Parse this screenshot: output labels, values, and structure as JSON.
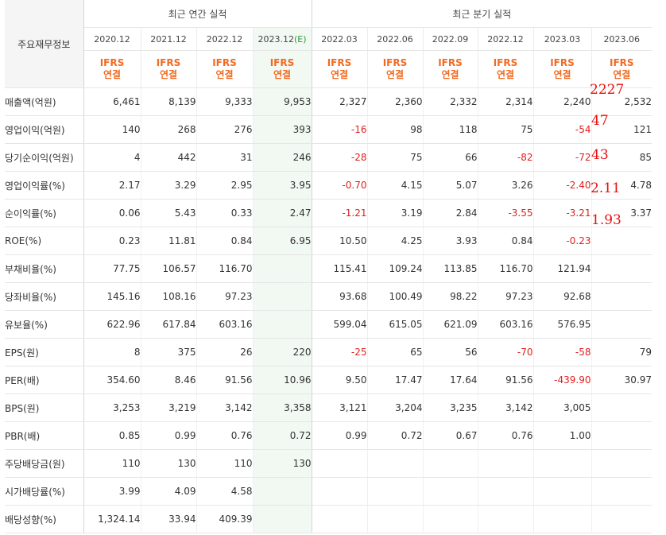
{
  "corner_label": "주요재무정보",
  "groups": {
    "annual": "최근 연간 실적",
    "quarter": "최근 분기 실적"
  },
  "periods": [
    "2020.12",
    "2021.12",
    "2022.12",
    "2023.12",
    "2022.03",
    "2022.06",
    "2022.09",
    "2022.12",
    "2023.03",
    "2023.06"
  ],
  "estimate_mark": "(E)",
  "basis_line1": "IFRS",
  "basis_line2": "연결",
  "rows": [
    {
      "label": "매출액(억원)",
      "values": [
        "6,461",
        "8,139",
        "9,333",
        "9,953",
        "2,327",
        "2,360",
        "2,332",
        "2,314",
        "2,240",
        "2,532"
      ]
    },
    {
      "label": "영업이익(억원)",
      "values": [
        "140",
        "268",
        "276",
        "393",
        "-16",
        "98",
        "118",
        "75",
        "-54",
        "121"
      ]
    },
    {
      "label": "당기순이익(억원)",
      "values": [
        "4",
        "442",
        "31",
        "246",
        "-28",
        "75",
        "66",
        "-82",
        "-72",
        "85"
      ]
    },
    {
      "label": "영업이익률(%)",
      "values": [
        "2.17",
        "3.29",
        "2.95",
        "3.95",
        "-0.70",
        "4.15",
        "5.07",
        "3.26",
        "-2.40",
        "4.78"
      ]
    },
    {
      "label": "순이익률(%)",
      "values": [
        "0.06",
        "5.43",
        "0.33",
        "2.47",
        "-1.21",
        "3.19",
        "2.84",
        "-3.55",
        "-3.21",
        "3.37"
      ]
    },
    {
      "label": "ROE(%)",
      "values": [
        "0.23",
        "11.81",
        "0.84",
        "6.95",
        "10.50",
        "4.25",
        "3.93",
        "0.84",
        "-0.23",
        ""
      ]
    },
    {
      "label": "부채비율(%)",
      "values": [
        "77.75",
        "106.57",
        "116.70",
        "",
        "115.41",
        "109.24",
        "113.85",
        "116.70",
        "121.94",
        ""
      ]
    },
    {
      "label": "당좌비율(%)",
      "values": [
        "145.16",
        "108.16",
        "97.23",
        "",
        "93.68",
        "100.49",
        "98.22",
        "97.23",
        "92.68",
        ""
      ]
    },
    {
      "label": "유보율(%)",
      "values": [
        "622.96",
        "617.84",
        "603.16",
        "",
        "599.04",
        "615.05",
        "621.09",
        "603.16",
        "576.95",
        ""
      ]
    },
    {
      "label": "EPS(원)",
      "values": [
        "8",
        "375",
        "26",
        "220",
        "-25",
        "65",
        "56",
        "-70",
        "-58",
        "79"
      ]
    },
    {
      "label": "PER(배)",
      "values": [
        "354.60",
        "8.46",
        "91.56",
        "10.96",
        "9.50",
        "17.47",
        "17.64",
        "91.56",
        "-439.90",
        "30.97"
      ]
    },
    {
      "label": "BPS(원)",
      "values": [
        "3,253",
        "3,219",
        "3,142",
        "3,358",
        "3,121",
        "3,204",
        "3,235",
        "3,142",
        "3,005",
        ""
      ]
    },
    {
      "label": "PBR(배)",
      "values": [
        "0.85",
        "0.99",
        "0.76",
        "0.72",
        "0.99",
        "0.72",
        "0.67",
        "0.76",
        "1.00",
        ""
      ]
    },
    {
      "label": "주당배당금(원)",
      "values": [
        "110",
        "130",
        "110",
        "130",
        "",
        "",
        "",
        "",
        "",
        ""
      ]
    },
    {
      "label": "시가배당률(%)",
      "values": [
        "3.99",
        "4.09",
        "4.58",
        "",
        "",
        "",
        "",
        "",
        "",
        ""
      ]
    },
    {
      "label": "배당성향(%)",
      "values": [
        "1,324.14",
        "33.94",
        "409.39",
        "",
        "",
        "",
        "",
        "",
        "",
        ""
      ]
    }
  ],
  "handwritten_notes": [
    "2227",
    "47",
    "43",
    "2.11",
    "1.93"
  ],
  "colors": {
    "basis_orange": "#f26a21",
    "negative_red": "#e01f1f",
    "estimate_bg": "#f2f8f2",
    "handwriting_red": "#e81010"
  }
}
